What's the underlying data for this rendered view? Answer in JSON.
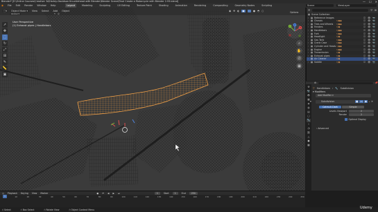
{
  "window": {
    "title": "Blender* [E:\\Online Courses\\Creative 'AI\\Harley-Davidson Knucklehead with Blender\\Blender Scene\\Final Create a Motorcycle with Blender 2.93.blend]",
    "controls": [
      "—",
      "☐",
      "✕"
    ]
  },
  "menubar": {
    "menus": [
      "File",
      "Edit",
      "Render",
      "Window",
      "Help"
    ],
    "workspaces": [
      "Layout",
      "Modeling",
      "Sculpting",
      "UV Editing",
      "Texture Paint",
      "Shading",
      "Animation",
      "Rendering",
      "Compositing",
      "Geometry Nodes",
      "Scripting"
    ],
    "active_workspace": "Layout",
    "scene": "Scene",
    "view_layer": "ViewLayer"
  },
  "viewport": {
    "mode": "Object Mode",
    "menus": [
      "View",
      "Select",
      "Add",
      "Object"
    ],
    "transform_orientation": "Global",
    "options_label": "Options",
    "info_line1": "User Perspective",
    "info_line2": "(1) Exhaust pipes | Handlebars",
    "gizmo": {
      "x": "X",
      "y": "Y",
      "z": "Z"
    }
  },
  "outliner": {
    "search_placeholder": "",
    "title": "Scene Collection",
    "rows": [
      {
        "name": "Reference Images",
        "icons": ""
      },
      {
        "name": "Chassis",
        "icons": "▽ ◉ ◆"
      },
      {
        "name": "Tires and Wheels",
        "icons": "▽ ◉ ◆"
      },
      {
        "name": "Fenders",
        "icons": "▽ ◉"
      },
      {
        "name": "Handlebars",
        "icons": "▽ ◉ ◆"
      },
      {
        "name": "Fork",
        "icons": "▽ ◉ ◆"
      },
      {
        "name": "Headlight",
        "icons": "▽ ◉"
      },
      {
        "name": "Gas Tank",
        "icons": "▽ ◉ ◆"
      },
      {
        "name": "Crank Case",
        "icons": "▽ ◉ ◆"
      },
      {
        "name": "Cylinder and Heads",
        "icons": "▽ ◉ ◆"
      },
      {
        "name": "Engine",
        "icons": "▽ ◉ ◆"
      },
      {
        "name": "Transmission",
        "icons": "▽ ◉"
      },
      {
        "name": "Exhaust pipes",
        "icons": "▽ ◉"
      },
      {
        "name": "Air Cleaner",
        "icons": "▽ ◉"
      },
      {
        "name": "Saddle",
        "icons": "▽ ◉"
      }
    ]
  },
  "properties": {
    "path_object": "Handlebars",
    "path_modifier": "Subdivision",
    "panel_title": "Modifiers",
    "add_modifier_label": "Add Modifier",
    "modifier_name": "Subdivision",
    "seg_catmull": "Catmull-Clark",
    "seg_simple": "Simple",
    "levels_viewport_label": "Levels Viewport",
    "levels_viewport_value": "2",
    "render_label": "Render",
    "render_value": "2",
    "optimal_label": "Optimal Display",
    "advanced_label": "Advanced"
  },
  "timeline": {
    "menus": [
      "Playback",
      "Keying",
      "View",
      "Marker"
    ],
    "current_frame": "1",
    "start_label": "Start",
    "start_value": "1",
    "end_label": "End",
    "end_value": "250",
    "ticks": [
      "0",
      "10",
      "20",
      "30",
      "40",
      "50",
      "60",
      "70",
      "80",
      "90",
      "100",
      "110",
      "120",
      "130",
      "140",
      "150",
      "160",
      "170",
      "180",
      "190",
      "200",
      "210",
      "220",
      "230",
      "240",
      "250"
    ]
  },
  "statusbar": {
    "items": [
      "Select",
      "Box Select",
      "Rotate View",
      "Object Context Menu"
    ]
  },
  "watermark": "Udemy"
}
